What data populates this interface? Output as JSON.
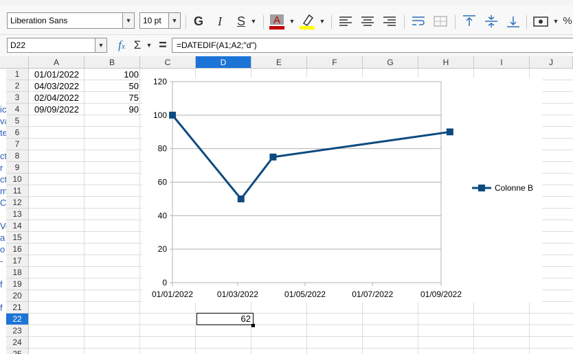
{
  "toolbar": {
    "font_name": "Liberation Sans",
    "font_size": "10 pt",
    "bold": "G",
    "italic": "I",
    "underline": "S",
    "font_color": "#c00000",
    "highlight_color": "#ffff00"
  },
  "formula_bar": {
    "cell_ref": "D22",
    "formula": "=DATEDIF(A1;A2;\"d\")"
  },
  "columns": [
    "A",
    "B",
    "C",
    "D",
    "E",
    "F",
    "G",
    "H",
    "I",
    "J"
  ],
  "selected_column": "D",
  "rows": [
    "1",
    "2",
    "3",
    "4",
    "5",
    "6",
    "7",
    "8",
    "9",
    "10",
    "11",
    "12",
    "13",
    "14",
    "15",
    "16",
    "17",
    "18",
    "19",
    "20",
    "21",
    "22",
    "23",
    "24",
    "25"
  ],
  "selected_row": "22",
  "cells": {
    "A1": "01/01/2022",
    "B1": "100",
    "A2": "04/03/2022",
    "B2": "50",
    "A3": "02/04/2022",
    "B3": "75",
    "A4": "09/09/2022",
    "B4": "90",
    "D22": "62"
  },
  "left_fragments": [
    "ic",
    "va",
    "te",
    "ct",
    "r",
    "ct",
    "m",
    "C",
    "Vo",
    "a",
    "o",
    "-",
    "f",
    "f"
  ],
  "chart_data": {
    "type": "line",
    "x": [
      "2022-01-01",
      "2022-03-04",
      "2022-04-02",
      "2022-09-09"
    ],
    "series": [
      {
        "name": "Colonne B",
        "values": [
          100,
          50,
          75,
          90
        ],
        "color": "#0d4a80"
      }
    ],
    "ylim": [
      0,
      120
    ],
    "yticks": [
      "0",
      "20",
      "40",
      "60",
      "80",
      "100",
      "120"
    ],
    "xticks": [
      {
        "date": "2022-01-01",
        "label": "01/01/2022"
      },
      {
        "date": "2022-03-01",
        "label": "01/03/2022"
      },
      {
        "date": "2022-05-01",
        "label": "01/05/2022"
      },
      {
        "date": "2022-07-01",
        "label": "01/07/2022"
      },
      {
        "date": "2022-09-01",
        "label": "01/09/2022"
      }
    ],
    "grid": true,
    "legend": "right"
  }
}
